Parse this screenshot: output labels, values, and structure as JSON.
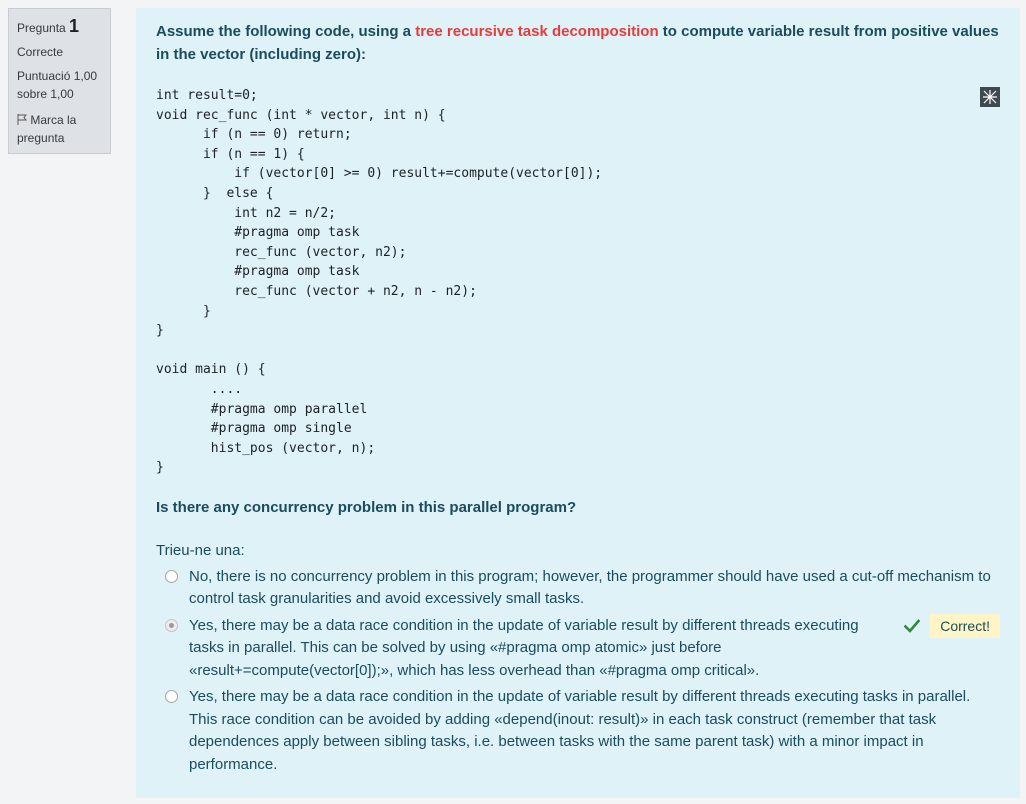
{
  "info": {
    "question_label": "Pregunta",
    "question_number": "1",
    "state": "Correcte",
    "grade": "Puntuació 1,00 sobre 1,00",
    "flag_label": "Marca la pregunta"
  },
  "question": {
    "intro_before": "Assume the following code, using a ",
    "intro_highlight": "tree recursive task decomposition",
    "intro_after": " to compute variable result from positive values in the vector (including zero):",
    "code": "int result=0;\nvoid rec_func (int * vector, int n) {\n      if (n == 0) return;\n      if (n == 1) {\n          if (vector[0] >= 0) result+=compute(vector[0]);\n      }  else {\n          int n2 = n/2;\n          #pragma omp task\n          rec_func (vector, n2);\n          #pragma omp task\n          rec_func (vector + n2, n - n2);\n      }\n}\n\nvoid main () {\n       ....\n       #pragma omp parallel\n       #pragma omp single\n       hist_pos (vector, n);\n}",
    "question": "Is there any concurrency problem in this parallel program?",
    "prompt": "Trieu-ne una:"
  },
  "answers": [
    {
      "text": "No, there is no concurrency problem in this program; however, the programmer should have used a cut-off mechanism to control task granularities and avoid excessively small tasks.",
      "selected": false
    },
    {
      "text": "Yes, there may be a data race condition in the update of variable result by different threads executing tasks in parallel. This can be solved by using «#pragma omp atomic» just before «result+=compute(vector[0]);», which has less overhead than «#pragma omp critical».",
      "selected": true
    },
    {
      "text": "Yes, there may be a data race condition in the update of variable result by different threads executing tasks in parallel. This race condition can be avoided by adding «depend(inout: result)» in each task construct (remember that task dependences apply between sibling tasks, i.e. between tasks with the same parent task) with a minor impact in performance.",
      "selected": false
    }
  ],
  "feedback": {
    "correct_label": "Correct!",
    "icon": "check-icon",
    "icon_color": "#2d8a3e"
  },
  "colors": {
    "content_bg": "#def2f8",
    "text_teal": "#1a4c5e",
    "highlight_red": "#ea3a3a",
    "badge_bg": "#fff5c6"
  }
}
